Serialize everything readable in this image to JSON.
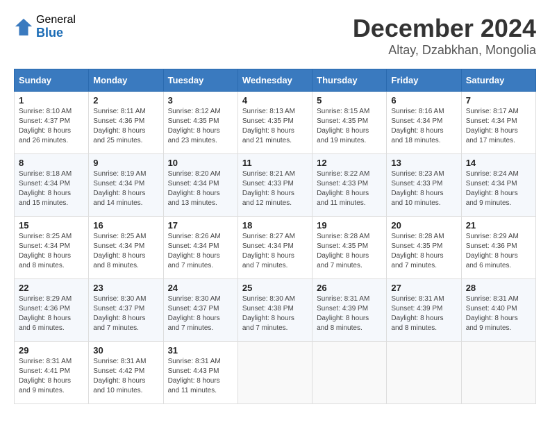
{
  "header": {
    "logo_general": "General",
    "logo_blue": "Blue",
    "month_title": "December 2024",
    "location": "Altay, Dzabkhan, Mongolia"
  },
  "calendar": {
    "days_of_week": [
      "Sunday",
      "Monday",
      "Tuesday",
      "Wednesday",
      "Thursday",
      "Friday",
      "Saturday"
    ],
    "weeks": [
      [
        {
          "day": "1",
          "sunrise": "8:10 AM",
          "sunset": "4:37 PM",
          "daylight": "8 hours and 26 minutes."
        },
        {
          "day": "2",
          "sunrise": "8:11 AM",
          "sunset": "4:36 PM",
          "daylight": "8 hours and 25 minutes."
        },
        {
          "day": "3",
          "sunrise": "8:12 AM",
          "sunset": "4:35 PM",
          "daylight": "8 hours and 23 minutes."
        },
        {
          "day": "4",
          "sunrise": "8:13 AM",
          "sunset": "4:35 PM",
          "daylight": "8 hours and 21 minutes."
        },
        {
          "day": "5",
          "sunrise": "8:15 AM",
          "sunset": "4:35 PM",
          "daylight": "8 hours and 19 minutes."
        },
        {
          "day": "6",
          "sunrise": "8:16 AM",
          "sunset": "4:34 PM",
          "daylight": "8 hours and 18 minutes."
        },
        {
          "day": "7",
          "sunrise": "8:17 AM",
          "sunset": "4:34 PM",
          "daylight": "8 hours and 17 minutes."
        }
      ],
      [
        {
          "day": "8",
          "sunrise": "8:18 AM",
          "sunset": "4:34 PM",
          "daylight": "8 hours and 15 minutes."
        },
        {
          "day": "9",
          "sunrise": "8:19 AM",
          "sunset": "4:34 PM",
          "daylight": "8 hours and 14 minutes."
        },
        {
          "day": "10",
          "sunrise": "8:20 AM",
          "sunset": "4:34 PM",
          "daylight": "8 hours and 13 minutes."
        },
        {
          "day": "11",
          "sunrise": "8:21 AM",
          "sunset": "4:33 PM",
          "daylight": "8 hours and 12 minutes."
        },
        {
          "day": "12",
          "sunrise": "8:22 AM",
          "sunset": "4:33 PM",
          "daylight": "8 hours and 11 minutes."
        },
        {
          "day": "13",
          "sunrise": "8:23 AM",
          "sunset": "4:33 PM",
          "daylight": "8 hours and 10 minutes."
        },
        {
          "day": "14",
          "sunrise": "8:24 AM",
          "sunset": "4:34 PM",
          "daylight": "8 hours and 9 minutes."
        }
      ],
      [
        {
          "day": "15",
          "sunrise": "8:25 AM",
          "sunset": "4:34 PM",
          "daylight": "8 hours and 8 minutes."
        },
        {
          "day": "16",
          "sunrise": "8:25 AM",
          "sunset": "4:34 PM",
          "daylight": "8 hours and 8 minutes."
        },
        {
          "day": "17",
          "sunrise": "8:26 AM",
          "sunset": "4:34 PM",
          "daylight": "8 hours and 7 minutes."
        },
        {
          "day": "18",
          "sunrise": "8:27 AM",
          "sunset": "4:34 PM",
          "daylight": "8 hours and 7 minutes."
        },
        {
          "day": "19",
          "sunrise": "8:28 AM",
          "sunset": "4:35 PM",
          "daylight": "8 hours and 7 minutes."
        },
        {
          "day": "20",
          "sunrise": "8:28 AM",
          "sunset": "4:35 PM",
          "daylight": "8 hours and 7 minutes."
        },
        {
          "day": "21",
          "sunrise": "8:29 AM",
          "sunset": "4:36 PM",
          "daylight": "8 hours and 6 minutes."
        }
      ],
      [
        {
          "day": "22",
          "sunrise": "8:29 AM",
          "sunset": "4:36 PM",
          "daylight": "8 hours and 6 minutes."
        },
        {
          "day": "23",
          "sunrise": "8:30 AM",
          "sunset": "4:37 PM",
          "daylight": "8 hours and 7 minutes."
        },
        {
          "day": "24",
          "sunrise": "8:30 AM",
          "sunset": "4:37 PM",
          "daylight": "8 hours and 7 minutes."
        },
        {
          "day": "25",
          "sunrise": "8:30 AM",
          "sunset": "4:38 PM",
          "daylight": "8 hours and 7 minutes."
        },
        {
          "day": "26",
          "sunrise": "8:31 AM",
          "sunset": "4:39 PM",
          "daylight": "8 hours and 8 minutes."
        },
        {
          "day": "27",
          "sunrise": "8:31 AM",
          "sunset": "4:39 PM",
          "daylight": "8 hours and 8 minutes."
        },
        {
          "day": "28",
          "sunrise": "8:31 AM",
          "sunset": "4:40 PM",
          "daylight": "8 hours and 9 minutes."
        }
      ],
      [
        {
          "day": "29",
          "sunrise": "8:31 AM",
          "sunset": "4:41 PM",
          "daylight": "8 hours and 9 minutes."
        },
        {
          "day": "30",
          "sunrise": "8:31 AM",
          "sunset": "4:42 PM",
          "daylight": "8 hours and 10 minutes."
        },
        {
          "day": "31",
          "sunrise": "8:31 AM",
          "sunset": "4:43 PM",
          "daylight": "8 hours and 11 minutes."
        },
        null,
        null,
        null,
        null
      ]
    ]
  }
}
